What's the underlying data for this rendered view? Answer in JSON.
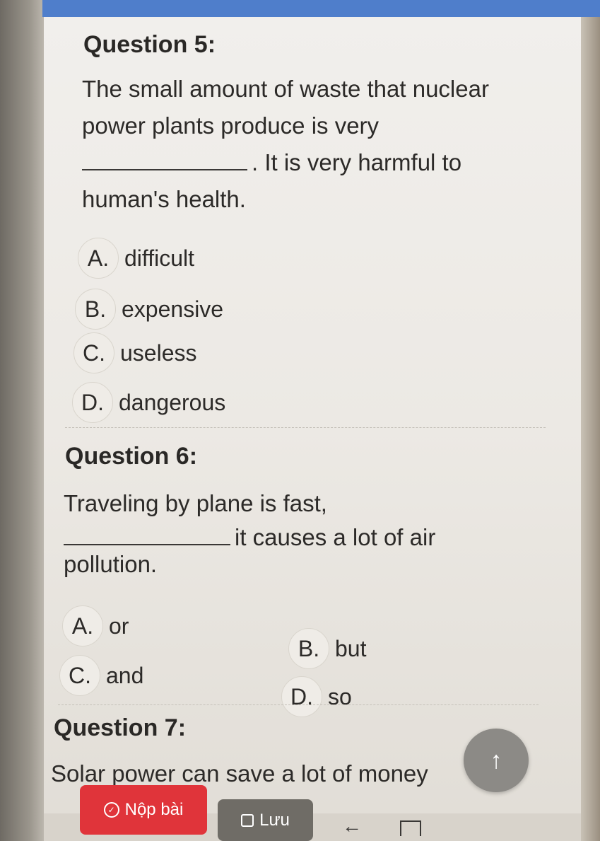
{
  "q5": {
    "title": "Question 5:",
    "line1": "The small amount of waste that nuclear",
    "line2": "power plants produce is very",
    "line3_after_blank": ". It is very harmful to",
    "line4": "human's health.",
    "options": [
      {
        "letter": "A.",
        "text": "difficult"
      },
      {
        "letter": "B.",
        "text": "expensive"
      },
      {
        "letter": "C.",
        "text": "useless"
      },
      {
        "letter": "D.",
        "text": "dangerous"
      }
    ]
  },
  "q6": {
    "title": "Question 6:",
    "line1": "Traveling by plane is fast,",
    "line2_after_blank": "it causes a lot of air",
    "line3": "pollution.",
    "options": [
      {
        "letter": "A.",
        "text": "or"
      },
      {
        "letter": "B.",
        "text": "but"
      },
      {
        "letter": "C.",
        "text": "and"
      },
      {
        "letter": "D.",
        "text": "so"
      }
    ]
  },
  "q7": {
    "title": "Question 7:",
    "line1": "Solar power can save a lot of money"
  },
  "buttons": {
    "submit_label": "Nộp bài",
    "save_label": "Lưu",
    "scroll_up": "↑"
  },
  "nav": {
    "back": "←"
  },
  "colors": {
    "submit": "#e0343a",
    "save": "#6f6c66",
    "topbar": "#4f7ecb"
  }
}
